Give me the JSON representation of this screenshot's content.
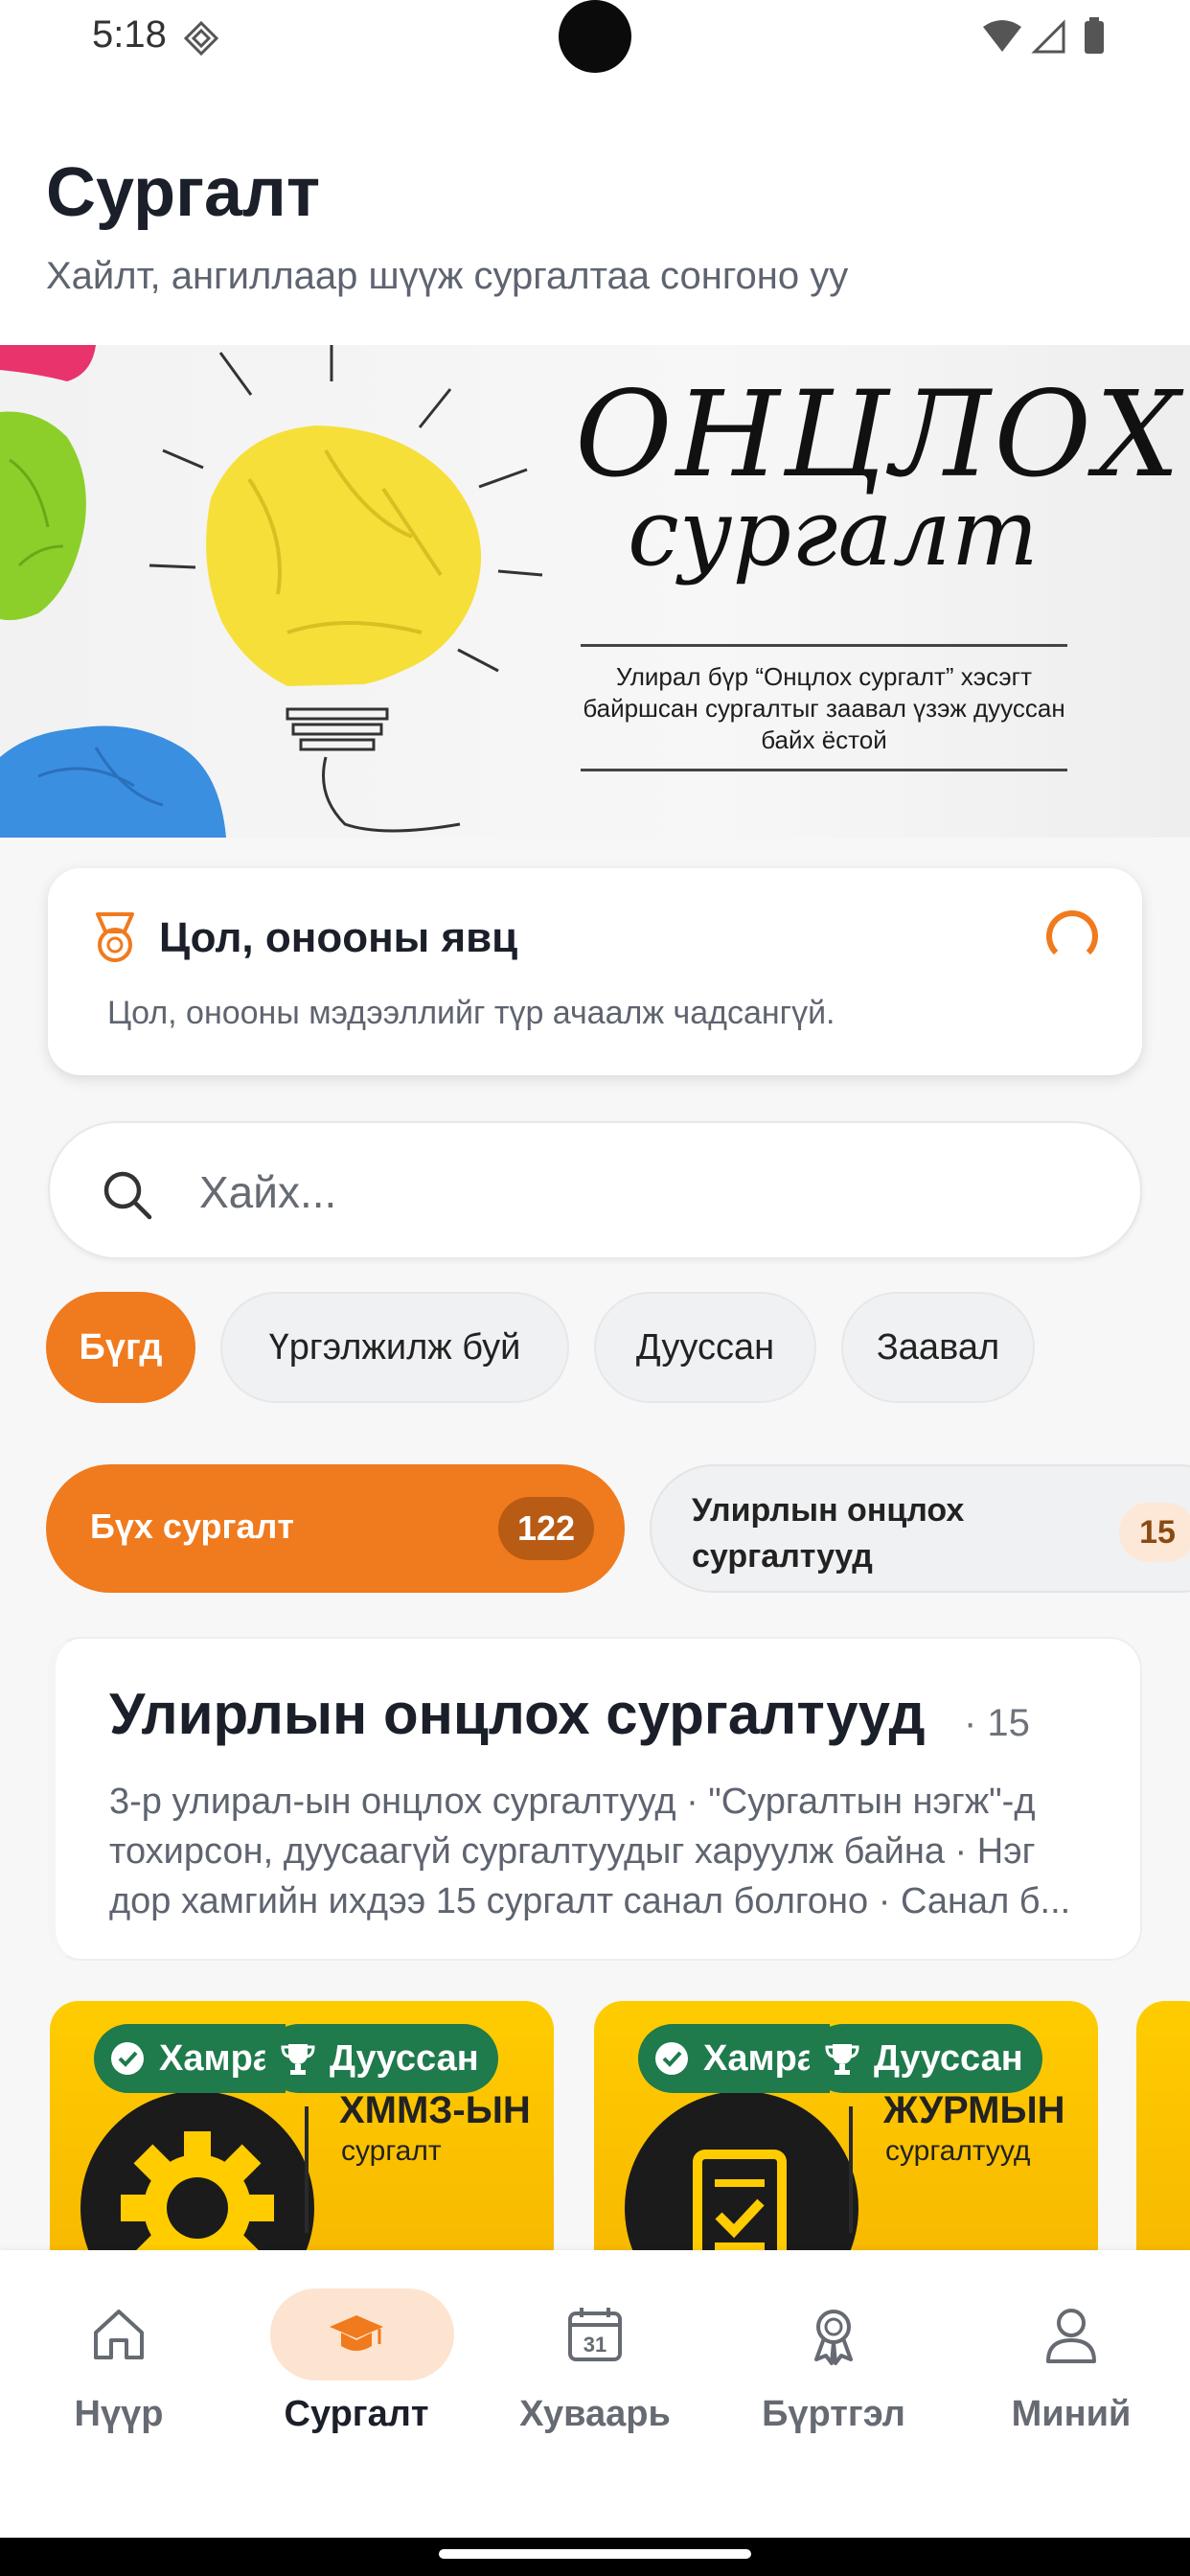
{
  "status_bar": {
    "time": "5:18"
  },
  "header": {
    "title": "Сургалт",
    "subtitle": "Хайлт, ангиллаар шүүж сургалтаа сонгоно уу"
  },
  "banner": {
    "title": "ОНЦЛОХ",
    "script": "сургалт",
    "caption": "Улирал бүр “Онцлох сургалт” хэсэгт байршсан сургалтыг заавал үзэж дууссан байх ёстой"
  },
  "rank_card": {
    "title": "Цол, онооны явц",
    "message": "Цол, онооны мэдээллийг түр ачаалж чадсангүй.",
    "accent_color": "#f07a1e"
  },
  "search": {
    "placeholder": "Хайх..."
  },
  "filters": [
    {
      "label": "Бүгд",
      "active": true
    },
    {
      "label": "Үргэлжилж буй",
      "active": false
    },
    {
      "label": "Дууссан",
      "active": false
    },
    {
      "label": "Заавал",
      "active": false
    }
  ],
  "categories": [
    {
      "label": "Бүх сургалт",
      "count": "122",
      "active": true
    },
    {
      "label": "Улирлын онцлох сургалтууд",
      "count": "15",
      "active": false
    }
  ],
  "section": {
    "title": "Улирлын онцлох сургалтууд",
    "count": "· 15",
    "description": "3-р улирал-ын онцлох сургалтууд · \"Сургалтын нэгж\"-д тохирсон, дуусаагүй сургалтуудыг харуулж байна · Нэг дор хамгийн ихдээ 15 сургалт санал болгоно · Санал б..."
  },
  "courses": [
    {
      "badge_covered": "Хамрагд",
      "badge_done": "Дууссан",
      "logo_text": "ХММЗ-ЫН",
      "logo_sub": "сургалт"
    },
    {
      "badge_covered": "Хамрагд",
      "badge_done": "Дууссан",
      "logo_text": "ЖУРМЫН",
      "logo_sub": "сургалтууд"
    }
  ],
  "bottom_nav": [
    {
      "label": "Нүүр",
      "icon": "home-icon",
      "active": false
    },
    {
      "label": "Сургалт",
      "icon": "graduation-cap-icon",
      "active": true
    },
    {
      "label": "Хуваарь",
      "icon": "calendar-icon",
      "active": false
    },
    {
      "label": "Бүртгэл",
      "icon": "award-icon",
      "active": false
    },
    {
      "label": "Миний",
      "icon": "user-icon",
      "active": false
    }
  ],
  "colors": {
    "accent": "#f07a1e",
    "badge_green": "#1f7a4c",
    "course_yellow": "#ffcc00"
  }
}
